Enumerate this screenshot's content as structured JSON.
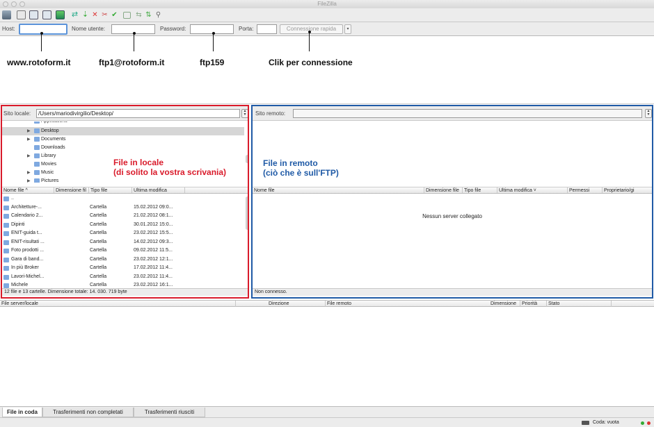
{
  "window": {
    "title": "FileZilla"
  },
  "toolbar": {
    "icons": [
      "site-manager-icon",
      "toggle-log-icon",
      "toggle-tree-local-icon",
      "toggle-tree-remote-icon",
      "toggle-queue-icon",
      "refresh-icon",
      "process-queue-icon",
      "cancel-icon",
      "disconnect-icon",
      "reconnect-icon",
      "filter-icon",
      "compare-icon",
      "sync-browse-icon",
      "search-icon"
    ]
  },
  "quickconnect": {
    "host_label": "Host:",
    "host_value": "",
    "user_label": "Nome utente:",
    "user_value": "",
    "pass_label": "Password:",
    "pass_value": "",
    "port_label": "Porta:",
    "port_value": "",
    "button_label": "Connessione rapida",
    "dropdown_glyph": "▾"
  },
  "callouts": {
    "host": "www.rotoform.it",
    "user": "ftp1@rotoform.it",
    "password": "ftp159",
    "connect": "Clik per connessione"
  },
  "local": {
    "site_label": "Sito locale:",
    "path": "/Users/mariodivirgilio/Desktop/",
    "tree": [
      {
        "label": "Applications",
        "arrow": "",
        "partial": true
      },
      {
        "label": "Desktop",
        "arrow": "▶",
        "selected": true
      },
      {
        "label": "Documents",
        "arrow": "▶"
      },
      {
        "label": "Downloads",
        "arrow": ""
      },
      {
        "label": "Library",
        "arrow": "▶"
      },
      {
        "label": "Movies",
        "arrow": ""
      },
      {
        "label": "Music",
        "arrow": "▶"
      },
      {
        "label": "Pictures",
        "arrow": "▶"
      }
    ],
    "annotation_line1": "File in locale",
    "annotation_line2": "(di solito la vostra scrivania)",
    "columns": [
      "Nome file ^",
      "Dimensione fil",
      "Tipo file",
      "Ultima modifica"
    ],
    "rows": [
      {
        "name": "..",
        "type": "",
        "date": ""
      },
      {
        "name": "Architetture-...",
        "type": "Cartella",
        "date": "15.02.2012 09:0..."
      },
      {
        "name": "Calendario 2...",
        "type": "Cartella",
        "date": "21.02.2012 08:1..."
      },
      {
        "name": "Dipinti",
        "type": "Cartella",
        "date": "30.01.2012 15:0..."
      },
      {
        "name": "ENIT-guida t...",
        "type": "Cartella",
        "date": "23.02.2012 15:5..."
      },
      {
        "name": "ENIT-risultati ...",
        "type": "Cartella",
        "date": "14.02.2012 09:3..."
      },
      {
        "name": "Foto prodotti ...",
        "type": "Cartella",
        "date": "09.02.2012 11:5..."
      },
      {
        "name": "Gara di band...",
        "type": "Cartella",
        "date": "23.02.2012 12:1..."
      },
      {
        "name": "In più Broker",
        "type": "Cartella",
        "date": "17.02.2012 11:4..."
      },
      {
        "name": "Lavori-Michel...",
        "type": "Cartella",
        "date": "23.02.2012 11:4..."
      },
      {
        "name": "Michele",
        "type": "Cartella",
        "date": "23.02.2012 16:1..."
      }
    ],
    "status": "12 file e 13 cartelle. Dimensione totale: 14. 030. 719 byte"
  },
  "remote": {
    "site_label": "Sito remoto:",
    "path": "",
    "annotation_line1": "File in remoto",
    "annotation_line2": "(ciò che è sull'FTP)",
    "columns": [
      "Nome file",
      "Dimensione file",
      "Tipo file",
      "Ultima modifica ˅",
      "Permessi",
      "Proprietario/gi"
    ],
    "empty_message": "Nessun server collegato",
    "status": "Non connesso."
  },
  "queue": {
    "columns": [
      "File server/locale",
      "Direzione",
      "File remoto",
      "Dimensione",
      "Priorità",
      "Stato"
    ]
  },
  "tabs": [
    "File in coda",
    "Trasferimenti non completati",
    "Trasferimenti riusciti"
  ],
  "statusbar": {
    "queue_label": "Coda: vuota"
  },
  "colors": {
    "local_border": "#d91a2a",
    "remote_border": "#1f5aa6",
    "local_annotation": "#d91a2a",
    "remote_annotation": "#1f5aa6",
    "folder": "#7fa9e0"
  }
}
